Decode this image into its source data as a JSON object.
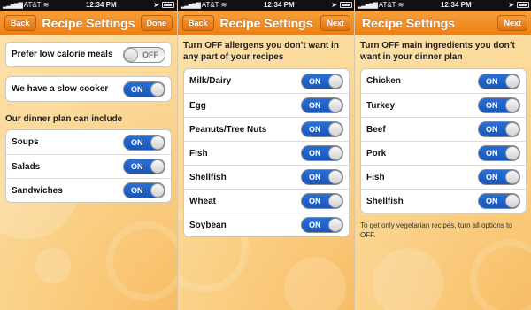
{
  "status_bar": {
    "carrier": "AT&T",
    "time": "12:34 PM"
  },
  "screen1": {
    "title": "Recipe Settings",
    "left_button": "Back",
    "right_button": "Done",
    "group1": [
      {
        "label": "Prefer low calorie meals",
        "state": "OFF"
      }
    ],
    "group2": [
      {
        "label": "We have a slow cooker",
        "state": "ON"
      }
    ],
    "section_header": "Our dinner plan can include",
    "group3": [
      {
        "label": "Soups",
        "state": "ON"
      },
      {
        "label": "Salads",
        "state": "ON"
      },
      {
        "label": "Sandwiches",
        "state": "ON"
      }
    ]
  },
  "screen2": {
    "title": "Recipe Settings",
    "left_button": "Back",
    "right_button": "Next",
    "section_header": "Turn OFF allergens you don’t want in any part of your recipes",
    "items": [
      {
        "label": "Milk/Dairy",
        "state": "ON"
      },
      {
        "label": "Egg",
        "state": "ON"
      },
      {
        "label": "Peanuts/Tree Nuts",
        "state": "ON"
      },
      {
        "label": "Fish",
        "state": "ON"
      },
      {
        "label": "Shellfish",
        "state": "ON"
      },
      {
        "label": "Wheat",
        "state": "ON"
      },
      {
        "label": "Soybean",
        "state": "ON"
      }
    ]
  },
  "screen3": {
    "title": "Recipe Settings",
    "right_button": "Next",
    "section_header": "Turn OFF main ingredients you don’t want in your dinner plan",
    "items": [
      {
        "label": "Chicken",
        "state": "ON"
      },
      {
        "label": "Turkey",
        "state": "ON"
      },
      {
        "label": "Beef",
        "state": "ON"
      },
      {
        "label": "Pork",
        "state": "ON"
      },
      {
        "label": "Fish",
        "state": "ON"
      },
      {
        "label": "Shellfish",
        "state": "ON"
      }
    ],
    "footnote": "To get only vegetarian recipes, turn all options to OFF."
  },
  "colors": {
    "navbar": "#ee7f13",
    "toggle_on": "#1a57b8",
    "background": "#fbd896"
  }
}
